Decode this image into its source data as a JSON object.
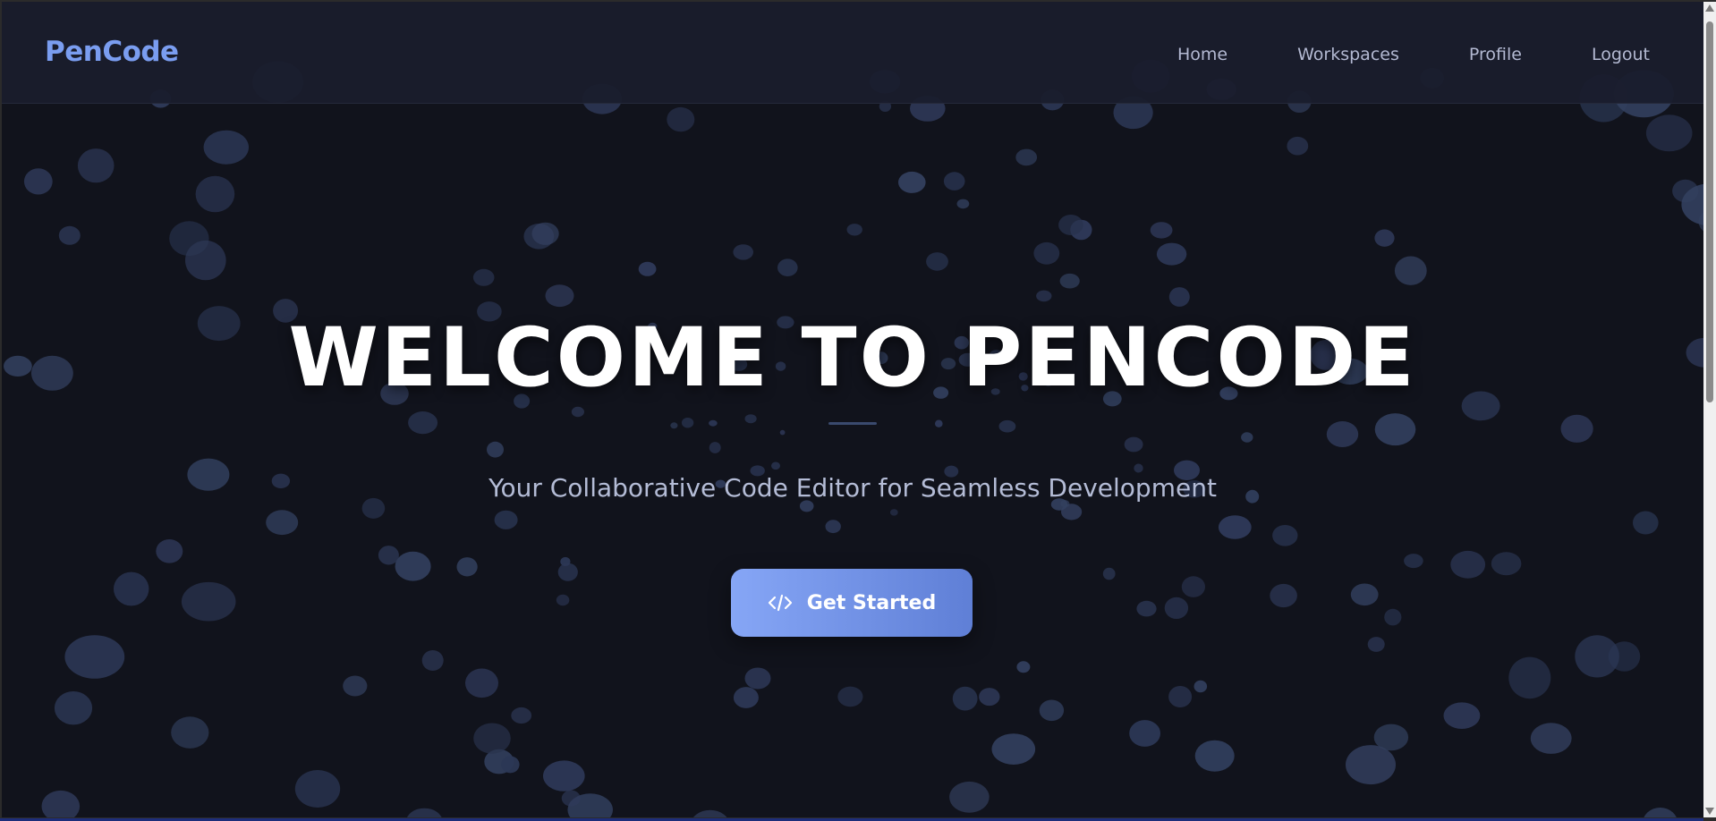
{
  "header": {
    "brand": "PenCode",
    "nav": [
      {
        "label": "Home"
      },
      {
        "label": "Workspaces"
      },
      {
        "label": "Profile"
      },
      {
        "label": "Logout"
      }
    ]
  },
  "hero": {
    "title": "WELCOME TO PENCODE",
    "subtitle": "Your Collaborative Code Editor for Seamless Development",
    "cta": {
      "label": "Get Started",
      "icon": "code-icon"
    }
  },
  "colors": {
    "background": "#11131c",
    "navbar": "#1a1d2d",
    "brand": "#7a9df0",
    "bubble": "#2f3a5a",
    "button_start": "#86a6f6",
    "button_end": "#5f7fd6"
  }
}
